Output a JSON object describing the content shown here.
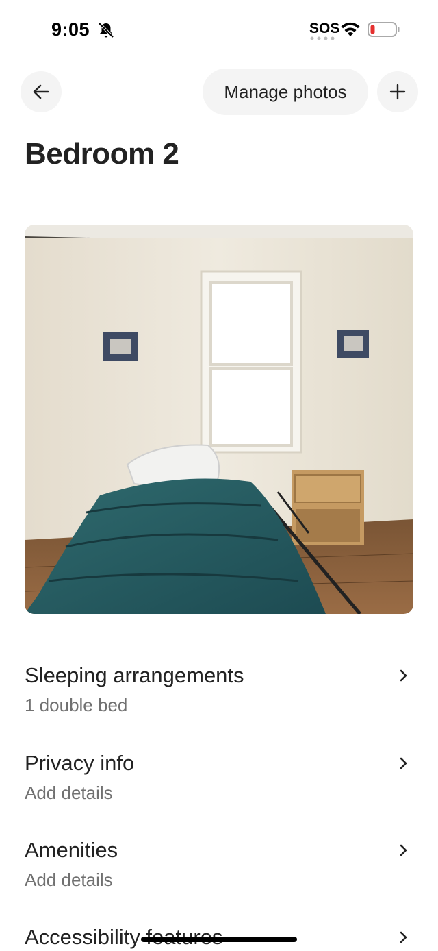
{
  "status_bar": {
    "time": "9:05",
    "sos": "SOS"
  },
  "header": {
    "manage_photos_label": "Manage photos"
  },
  "page_title": "Bedroom 2",
  "photo": {
    "description_icon": "bedroom-photo"
  },
  "rows": [
    {
      "title": "Sleeping arrangements",
      "subtitle": "1 double bed"
    },
    {
      "title": "Privacy info",
      "subtitle": "Add details"
    },
    {
      "title": "Amenities",
      "subtitle": "Add details"
    },
    {
      "title": "Accessibility features",
      "subtitle": ""
    }
  ],
  "colors": {
    "text_primary": "#222222",
    "text_secondary": "#717171",
    "button_bg": "#f4f4f4",
    "battery_low": "#e5302f"
  }
}
